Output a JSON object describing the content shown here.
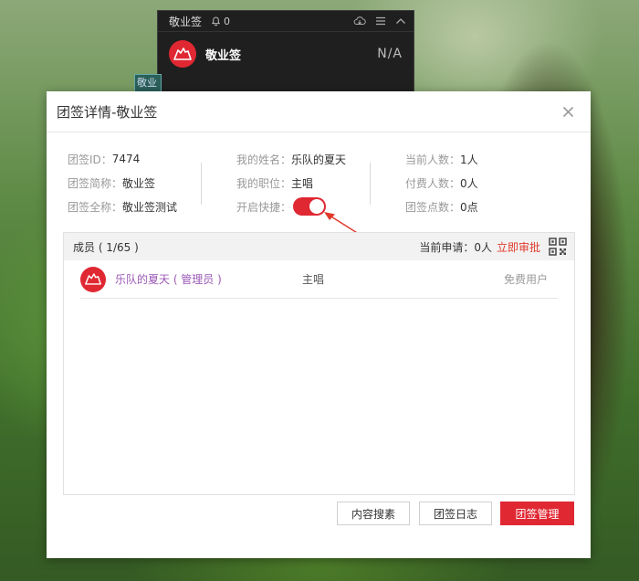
{
  "widget": {
    "title": "敬业签",
    "notify_count": "0",
    "group_name": "敬业签",
    "status": "N/A",
    "peek_text": "敬业签"
  },
  "peek_tile": {
    "text": "敬业"
  },
  "dialog": {
    "title": "团签详情-敬业签",
    "info": {
      "col1": [
        {
          "label": "团签ID：",
          "value": "7474"
        },
        {
          "label": "团签简称：",
          "value": "敬业签"
        },
        {
          "label": "团签全称：",
          "value": "敬业签测试"
        }
      ],
      "col2": [
        {
          "label": "我的姓名：",
          "value": "乐队的夏天"
        },
        {
          "label": "我的职位：",
          "value": "主唱"
        },
        {
          "label": "开启快捷：",
          "value": ""
        }
      ],
      "col3": [
        {
          "label": "当前人数：",
          "value": "1人"
        },
        {
          "label": "付费人数：",
          "value": "0人"
        },
        {
          "label": "团签点数：",
          "value": "0点"
        }
      ]
    },
    "quick_toggle_on": true,
    "members": {
      "header": "成员 ( 1/65 )",
      "apply_label": "当前申请：",
      "apply_count": "0人",
      "approve_link": "立即审批",
      "rows": [
        {
          "name": "乐队的夏天 ( 管理员 )",
          "role": "主唱",
          "type": "免费用户"
        }
      ]
    },
    "buttons": {
      "search": "内容搜素",
      "log": "团签日志",
      "manage": "团签管理"
    }
  },
  "colors": {
    "accent": "#e02833",
    "admin_name": "#9b59b6",
    "approve_link": "#e0392b"
  }
}
